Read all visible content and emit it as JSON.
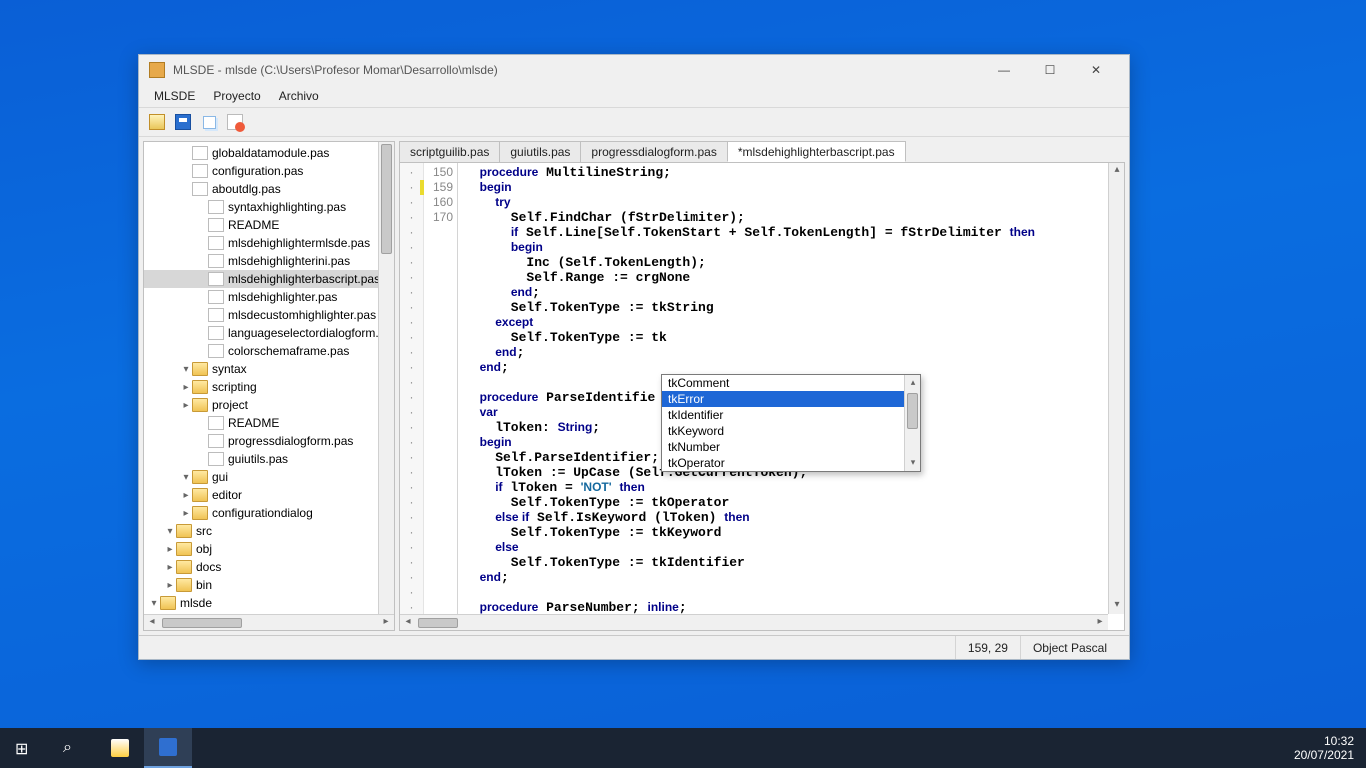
{
  "window": {
    "title": "MLSDE - mlsde (C:\\Users\\Profesor Momar\\Desarrollo\\mlsde)"
  },
  "menu": {
    "items": [
      "MLSDE",
      "Proyecto",
      "Archivo"
    ]
  },
  "toolbar_icons": [
    "open",
    "save",
    "copy",
    "delete"
  ],
  "tree": [
    {
      "lvl": 0,
      "caret": "▾",
      "icon": "folder",
      "label": "mlsde"
    },
    {
      "lvl": 1,
      "caret": "▸",
      "icon": "folder",
      "label": "bin"
    },
    {
      "lvl": 1,
      "caret": "▸",
      "icon": "folder",
      "label": "docs"
    },
    {
      "lvl": 1,
      "caret": "▸",
      "icon": "folder",
      "label": "obj"
    },
    {
      "lvl": 1,
      "caret": "▾",
      "icon": "folder",
      "label": "src"
    },
    {
      "lvl": 2,
      "caret": "▸",
      "icon": "folder",
      "label": "configurationdialog"
    },
    {
      "lvl": 2,
      "caret": "▸",
      "icon": "folder",
      "label": "editor"
    },
    {
      "lvl": 2,
      "caret": "▾",
      "icon": "folder",
      "label": "gui"
    },
    {
      "lvl": 3,
      "caret": "",
      "icon": "file",
      "label": "guiutils.pas"
    },
    {
      "lvl": 3,
      "caret": "",
      "icon": "file",
      "label": "progressdialogform.pas"
    },
    {
      "lvl": 3,
      "caret": "",
      "icon": "file",
      "label": "README"
    },
    {
      "lvl": 2,
      "caret": "▸",
      "icon": "folder",
      "label": "project"
    },
    {
      "lvl": 2,
      "caret": "▸",
      "icon": "folder",
      "label": "scripting"
    },
    {
      "lvl": 2,
      "caret": "▾",
      "icon": "folder",
      "label": "syntax"
    },
    {
      "lvl": 3,
      "caret": "",
      "icon": "file",
      "label": "colorschemaframe.pas"
    },
    {
      "lvl": 3,
      "caret": "",
      "icon": "file",
      "label": "languageselectordialogform.p"
    },
    {
      "lvl": 3,
      "caret": "",
      "icon": "file",
      "label": "mlsdecustomhighlighter.pas"
    },
    {
      "lvl": 3,
      "caret": "",
      "icon": "file",
      "label": "mlsdehighlighter.pas"
    },
    {
      "lvl": 3,
      "caret": "",
      "icon": "file",
      "label": "mlsdehighlighterbascript.pas",
      "sel": true
    },
    {
      "lvl": 3,
      "caret": "",
      "icon": "file",
      "label": "mlsdehighlighterini.pas"
    },
    {
      "lvl": 3,
      "caret": "",
      "icon": "file",
      "label": "mlsdehighlightermlsde.pas"
    },
    {
      "lvl": 3,
      "caret": "",
      "icon": "file",
      "label": "README"
    },
    {
      "lvl": 3,
      "caret": "",
      "icon": "file",
      "label": "syntaxhighlighting.pas"
    },
    {
      "lvl": 2,
      "caret": "",
      "icon": "file",
      "label": "aboutdlg.pas"
    },
    {
      "lvl": 2,
      "caret": "",
      "icon": "file",
      "label": "configuration.pas"
    },
    {
      "lvl": 2,
      "caret": "",
      "icon": "file",
      "label": "globaldatamodule.pas"
    }
  ],
  "tabs": [
    {
      "label": "scriptguilib.pas"
    },
    {
      "label": "guiutils.pas"
    },
    {
      "label": "progressdialogform.pas"
    },
    {
      "label": "*mlsdehighlighterbascript.pas",
      "active": true
    }
  ],
  "gutter": {
    "lines": 30,
    "nums": {
      "2": "150",
      "13": "159",
      "14": "160",
      "23": "170"
    },
    "marks": {
      "13": "yellow"
    }
  },
  "code_lines": [
    "  <kw>procedure</kw> MultilineString;",
    "  <kw>begin</kw>",
    "    <kw>try</kw>",
    "      Self.FindChar (fStrDelimiter);",
    "      <kw>if</kw> Self.Line[Self.TokenStart + Self.TokenLength] = fStrDelimiter <kw>then</kw>",
    "      <kw>begin</kw>",
    "        Inc (Self.TokenLength);",
    "        Self.Range := crgNone",
    "      <kw>end</kw>;",
    "      Self.TokenType := tkString",
    "    <kw>except</kw>",
    "      Self.TokenType := tk",
    "    <kw>end</kw>;",
    "  <kw>end</kw>;",
    "",
    "  <kw>procedure</kw> ParseIdentifie",
    "  <kw>var</kw>",
    "    lToken: <kw>String</kw>;",
    "  <kw>begin</kw>",
    "    Self.ParseIdentifier;",
    "    lToken := UpCase (Self.GetCurrentToken);",
    "    <kw>if</kw> lToken = <str>'NOT'</str> <kw>then</kw>",
    "      Self.TokenType := tkOperator",
    "    <kw>else if</kw> Self.IsKeyword (lToken) <kw>then</kw>",
    "      Self.TokenType := tkKeyword",
    "    <kw>else</kw>",
    "      Self.TokenType := tkIdentifier",
    "  <kw>end</kw>;",
    "",
    "  <kw>procedure</kw> ParseNumber; <kw>inline</kw>;"
  ],
  "completion": {
    "items": [
      {
        "label": "tkComment"
      },
      {
        "label": "tkError",
        "sel": true
      },
      {
        "label": "tkIdentifier"
      },
      {
        "label": "tkKeyword"
      },
      {
        "label": "tkNumber"
      },
      {
        "label": "tkOperator"
      }
    ]
  },
  "status": {
    "pos": "159, 29",
    "lang": "Object Pascal"
  },
  "taskbar": {
    "time": "10:32",
    "date": "20/07/2021"
  }
}
